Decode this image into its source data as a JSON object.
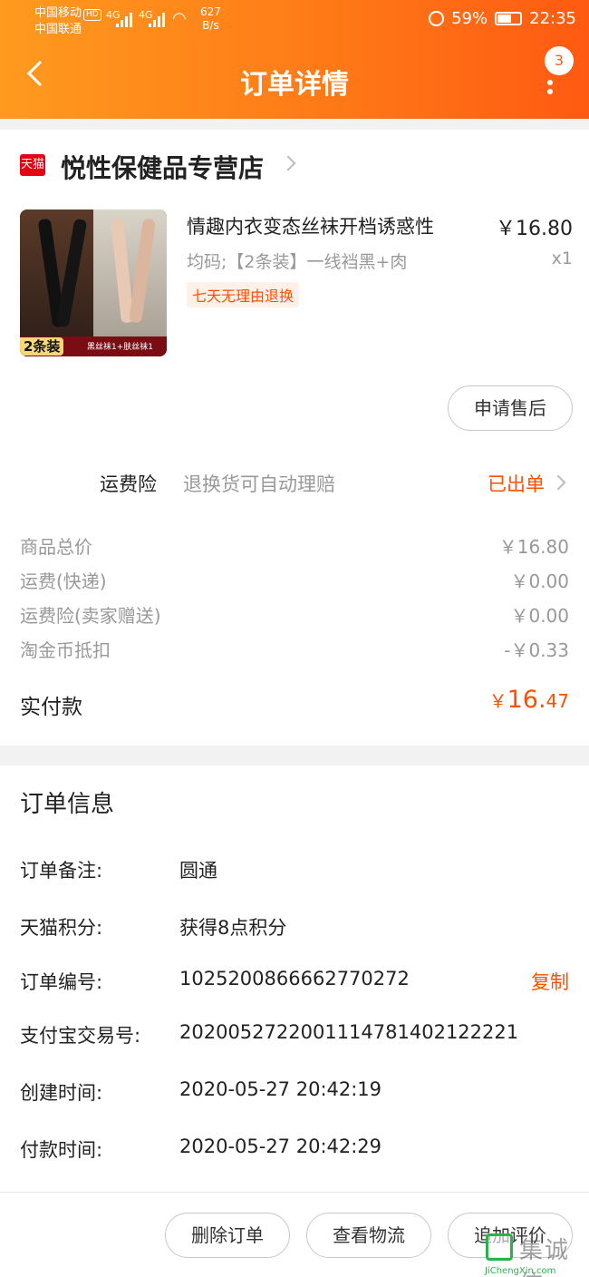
{
  "status_bar": {
    "carrier1": "中国移动",
    "hd": "HD",
    "carrier2": "中国联通",
    "signal1": "4G",
    "signal2": "4G",
    "speed_value": "627",
    "speed_unit": "B/s",
    "battery": "59%",
    "time": "22:35"
  },
  "header": {
    "title": "订单详情",
    "notification_count": "3",
    "back_icon": "chevron-left-icon",
    "menu_icon": "more-vertical-icon",
    "gradient_colors": [
      "#ff9a1e",
      "#ff5a12"
    ]
  },
  "store": {
    "logo_text": "天猫",
    "name": "悦性保健品专营店"
  },
  "product": {
    "name": "情趣内衣变态丝袜开档诱惑性",
    "price": "￥16.80",
    "sku": "均码;【2条装】一线裆黑+肉",
    "qty": "x1",
    "promo_tag": "七天无理由退换",
    "thumb_tag": "2条装",
    "thumb_caption": "黑丝袜1+肤丝袜1"
  },
  "after_sale_button": "申请售后",
  "insurance": {
    "label": "运费险",
    "desc": "退换货可自动理赔",
    "status": "已出单"
  },
  "costs": [
    {
      "label": "商品总价",
      "value": "￥16.80"
    },
    {
      "label": "运费(快递)",
      "value": "￥0.00"
    },
    {
      "label": "运费险(卖家赠送)",
      "value": "￥0.00"
    },
    {
      "label": "淘金币抵扣",
      "value": "-￥0.33"
    }
  ],
  "paid": {
    "label": "实付款",
    "currency": "￥",
    "integer": "16.",
    "decimal": "47"
  },
  "order_info": {
    "title": "订单信息",
    "rows": [
      {
        "label": "订单备注:",
        "value": "圆通"
      },
      {
        "label": "天猫积分:",
        "value": "获得8点积分"
      },
      {
        "label": "订单编号:",
        "value": "1025200866662770272",
        "action": "复制"
      },
      {
        "label": "支付宝交易号:",
        "value": "2020052722001114781402122221"
      },
      {
        "label": "创建时间:",
        "value": "2020-05-27 20:42:19"
      },
      {
        "label": "付款时间:",
        "value": "2020-05-27 20:42:29"
      }
    ]
  },
  "bottom_buttons": [
    "删除订单",
    "查看物流",
    "追加评价"
  ],
  "watermark": {
    "text": "集诚信",
    "url": "JiChengXin.com"
  },
  "colors": {
    "accent": "#ff5000",
    "tmall_red": "#e50012"
  }
}
